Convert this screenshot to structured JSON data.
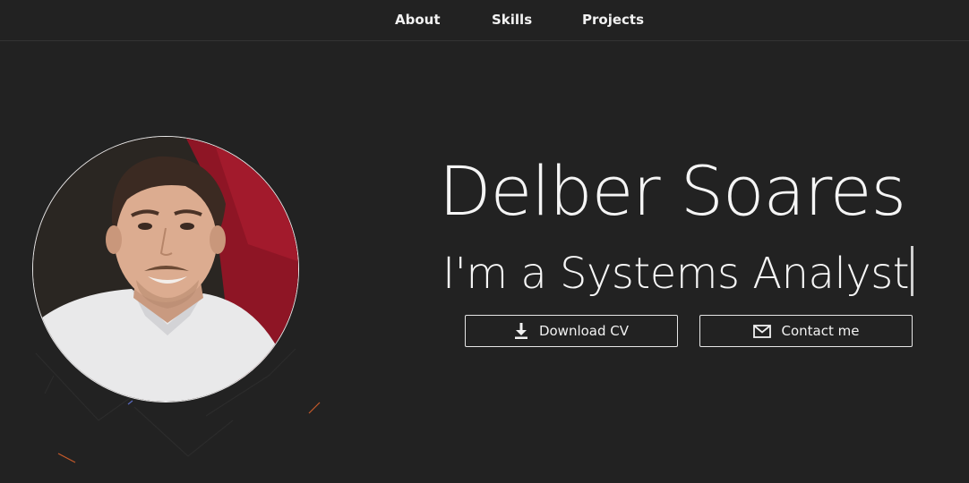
{
  "nav": {
    "items": [
      {
        "label": "About"
      },
      {
        "label": "Skills"
      },
      {
        "label": "Projects"
      }
    ]
  },
  "hero": {
    "name": "Delber Soares",
    "role": "I'm a Systems Analyst"
  },
  "buttons": {
    "download": {
      "label": "Download CV",
      "icon": "download-icon"
    },
    "contact": {
      "label": "Contact me",
      "icon": "mail-icon"
    }
  },
  "avatar": {
    "icon": "profile-photo"
  },
  "colors": {
    "background": "#222222",
    "text": "#f5f5f5",
    "border": "#e6e6e6",
    "deco_orange": "#c45a2a",
    "deco_blue": "#5a6abf"
  }
}
